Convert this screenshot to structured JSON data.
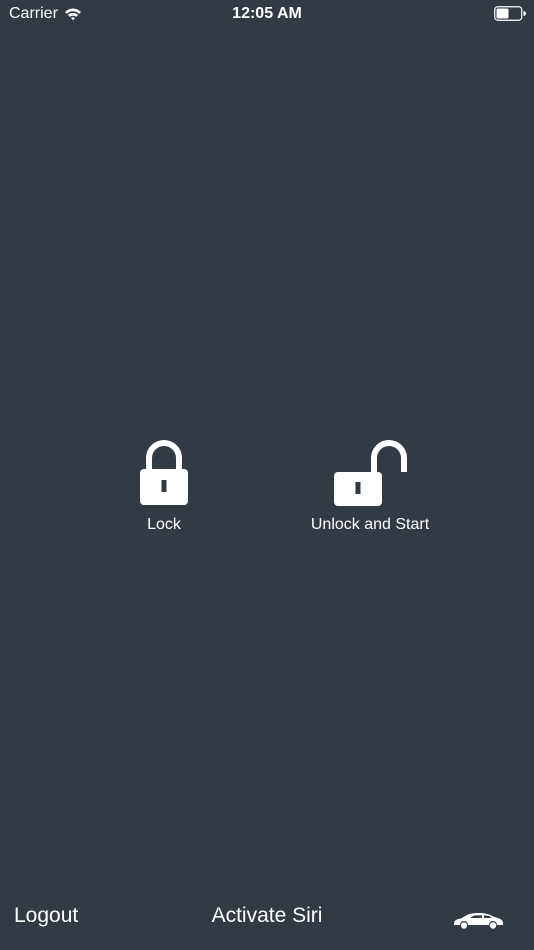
{
  "status_bar": {
    "carrier": "Carrier",
    "time": "12:05 AM",
    "battery_level": 0.5
  },
  "actions": {
    "lock_label": "Lock",
    "unlock_label": "Unlock and Start"
  },
  "bottom_bar": {
    "logout_label": "Logout",
    "siri_label": "Activate Siri",
    "car_icon": "car-icon"
  },
  "colors": {
    "background": "#323a44",
    "foreground": "#ffffff"
  }
}
